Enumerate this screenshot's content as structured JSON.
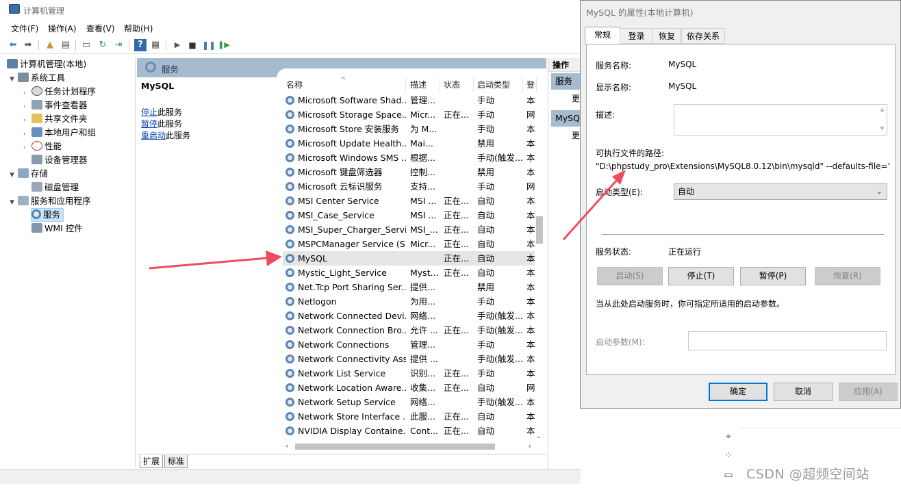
{
  "main": {
    "title": "计算机管理",
    "menu": [
      "文件(F)",
      "操作(A)",
      "查看(V)",
      "帮助(H)"
    ]
  },
  "tree": {
    "root": "计算机管理(本地)",
    "system_tools": "系统工具",
    "task_scheduler": "任务计划程序",
    "event_viewer": "事件查看器",
    "shared_folders": "共享文件夹",
    "local_users": "本地用户和组",
    "performance": "性能",
    "device_manager": "设备管理器",
    "storage": "存储",
    "disk_management": "磁盘管理",
    "services_apps": "服务和应用程序",
    "services": "服务",
    "wmi": "WMI 控件"
  },
  "services_pane": {
    "header": "服务",
    "selected_name": "MySQL",
    "links": [
      {
        "link": "停止",
        "rest": "此服务"
      },
      {
        "link": "暂停",
        "rest": "此服务"
      },
      {
        "link": "重启动",
        "rest": "此服务"
      }
    ],
    "columns": [
      "名称",
      "描述",
      "状态",
      "启动类型",
      "登"
    ],
    "rows": [
      {
        "name": "Microsoft Software Shad...",
        "desc": "管理...",
        "status": "",
        "startup": "手动",
        "logon": "本"
      },
      {
        "name": "Microsoft Storage Space...",
        "desc": "Micr...",
        "status": "正在...",
        "startup": "手动",
        "logon": "网"
      },
      {
        "name": "Microsoft Store 安装服务",
        "desc": "为 M...",
        "status": "",
        "startup": "手动",
        "logon": "本"
      },
      {
        "name": "Microsoft Update Health...",
        "desc": "Mai...",
        "status": "",
        "startup": "禁用",
        "logon": "本"
      },
      {
        "name": "Microsoft Windows SMS ...",
        "desc": "根据...",
        "status": "",
        "startup": "手动(触发...",
        "logon": "本"
      },
      {
        "name": "Microsoft 键盘筛选器",
        "desc": "控制...",
        "status": "",
        "startup": "禁用",
        "logon": "本"
      },
      {
        "name": "Microsoft 云标识服务",
        "desc": "支持...",
        "status": "",
        "startup": "手动",
        "logon": "网"
      },
      {
        "name": "MSI Center Service",
        "desc": "MSI ...",
        "status": "正在...",
        "startup": "自动",
        "logon": "本"
      },
      {
        "name": "MSI_Case_Service",
        "desc": "MSI ...",
        "status": "正在...",
        "startup": "自动",
        "logon": "本"
      },
      {
        "name": "MSI_Super_Charger_Servi...",
        "desc": "MSI_...",
        "status": "正在...",
        "startup": "自动",
        "logon": "本"
      },
      {
        "name": "MSPCManager Service (S...",
        "desc": "Micr...",
        "status": "正在...",
        "startup": "自动",
        "logon": "本"
      },
      {
        "name": "MySQL",
        "desc": "",
        "status": "正在...",
        "startup": "自动",
        "logon": "本",
        "selected": true
      },
      {
        "name": "Mystic_Light_Service",
        "desc": "Myst...",
        "status": "正在...",
        "startup": "自动",
        "logon": "本"
      },
      {
        "name": "Net.Tcp Port Sharing Ser...",
        "desc": "提供...",
        "status": "",
        "startup": "禁用",
        "logon": "本"
      },
      {
        "name": "Netlogon",
        "desc": "为用...",
        "status": "",
        "startup": "手动",
        "logon": "本"
      },
      {
        "name": "Network Connected Devi...",
        "desc": "网络...",
        "status": "",
        "startup": "手动(触发...",
        "logon": "本"
      },
      {
        "name": "Network Connection Bro...",
        "desc": "允许 ...",
        "status": "正在...",
        "startup": "手动(触发...",
        "logon": "本"
      },
      {
        "name": "Network Connections",
        "desc": "管理...",
        "status": "",
        "startup": "手动",
        "logon": "本"
      },
      {
        "name": "Network Connectivity Ass...",
        "desc": "提供 ...",
        "status": "",
        "startup": "手动(触发...",
        "logon": "本"
      },
      {
        "name": "Network List Service",
        "desc": "识别...",
        "status": "正在...",
        "startup": "手动",
        "logon": "本"
      },
      {
        "name": "Network Location Aware...",
        "desc": "收集...",
        "status": "正在...",
        "startup": "自动",
        "logon": "网"
      },
      {
        "name": "Network Setup Service",
        "desc": "网络...",
        "status": "",
        "startup": "手动(触发...",
        "logon": "本"
      },
      {
        "name": "Network Store Interface ...",
        "desc": "此服...",
        "status": "正在...",
        "startup": "自动",
        "logon": "本"
      },
      {
        "name": "NVIDIA Display Containe...",
        "desc": "Cont...",
        "status": "正在...",
        "startup": "自动",
        "logon": "本"
      }
    ],
    "bottom_tabs": [
      "扩展",
      "标准"
    ]
  },
  "actions": {
    "header": "操作",
    "group1": "服务",
    "item1": "更",
    "group2": "MySQL",
    "item2": "更"
  },
  "dialog": {
    "title": "MySQL 的属性(本地计算机)",
    "tabs": [
      "常规",
      "登录",
      "恢复",
      "依存关系"
    ],
    "service_name_label": "服务名称:",
    "service_name": "MySQL",
    "display_name_label": "显示名称:",
    "display_name": "MySQL",
    "description_label": "描述:",
    "description": "",
    "exe_path_label": "可执行文件的路径:",
    "exe_path": "\"D:\\phpstudy_pro\\Extensions\\MySQL8.0.12\\bin\\mysqld\" --defaults-file='",
    "startup_type_label": "启动类型(E):",
    "startup_type": "自动",
    "status_label": "服务状态:",
    "status_value": "正在运行",
    "start_btn": "启动(S)",
    "stop_btn": "停止(T)",
    "pause_btn": "暂停(P)",
    "resume_btn": "恢复(R)",
    "hint": "当从此处启动服务时，你可指定所适用的启动参数。",
    "param_label": "启动参数(M):",
    "param_value": "",
    "ok": "确定",
    "cancel": "取消",
    "apply": "应用(A)"
  },
  "watermark": "CSDN @超频空间站",
  "colors": {
    "arrow": "#ef4b5c",
    "accent": "#0078d7",
    "header_band": "#a7bbd0"
  },
  "icons": [
    "computer-icon",
    "tools-icon",
    "clock-icon",
    "event-icon",
    "folder-icon",
    "users-icon",
    "performance-icon",
    "device-icon",
    "storage-icon",
    "disk-icon",
    "services-app-icon",
    "gear-icon",
    "wmi-icon"
  ]
}
